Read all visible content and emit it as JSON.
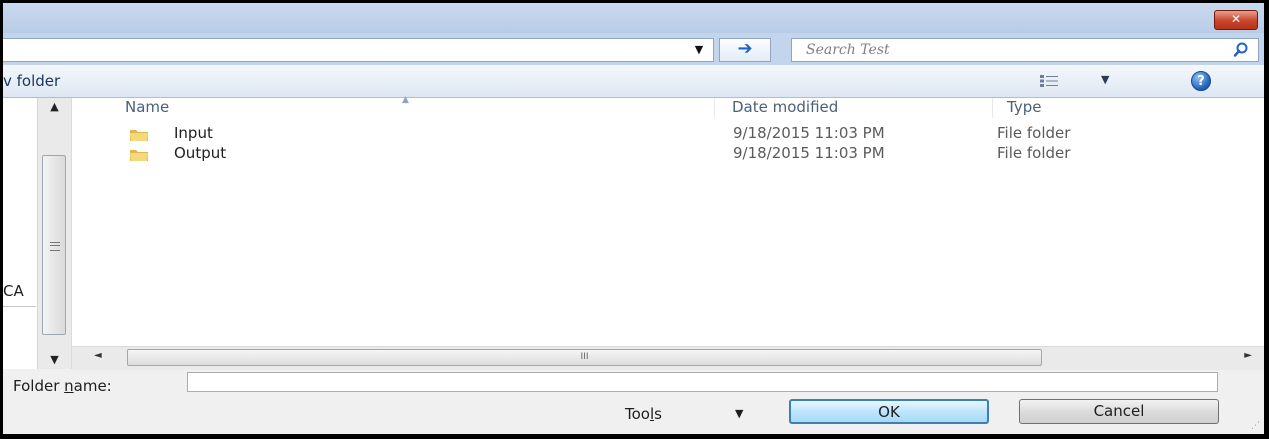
{
  "search": {
    "placeholder": "Search Test"
  },
  "toolbar": {
    "new_folder_label": "v folder"
  },
  "nav_pane": {
    "label": "CA"
  },
  "columns": {
    "name": "Name",
    "date": "Date modified",
    "type": "Type"
  },
  "files": [
    {
      "name": "Input",
      "date": "9/18/2015 11:03 PM",
      "type": "File folder"
    },
    {
      "name": "Output",
      "date": "9/18/2015 11:03 PM",
      "type": "File folder"
    }
  ],
  "footer": {
    "folder_name_prefix": "Folder ",
    "folder_name_access": "n",
    "folder_name_suffix": "ame:",
    "folder_name_value": "",
    "tools_prefix": "Too",
    "tools_access": "l",
    "tools_suffix": "s",
    "ok_label": "OK",
    "cancel_label": "Cancel"
  },
  "icons": {
    "close": "close-icon",
    "address_dropdown": "chevron-down-icon",
    "go": "arrow-right-icon",
    "search": "search-icon",
    "view": "view-list-icon",
    "help": "help-icon",
    "folder": "folder-icon"
  },
  "colors": {
    "accent": "#3c7fb1",
    "close": "#c8442c",
    "title": "#c3d5ec"
  }
}
